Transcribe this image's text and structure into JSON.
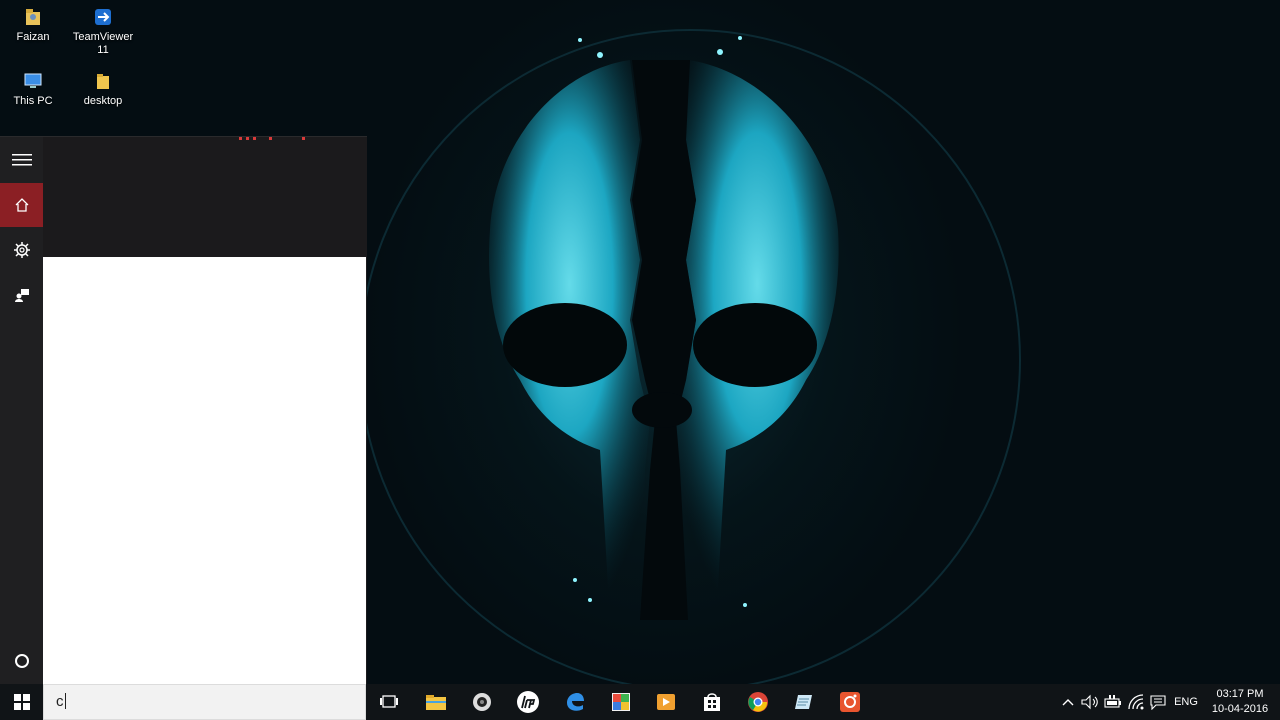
{
  "desktop": {
    "icons": [
      {
        "label": "Faizan",
        "icon": "user-folder-icon"
      },
      {
        "label": "TeamViewer 11",
        "icon": "teamviewer-icon"
      },
      {
        "label": "This PC",
        "icon": "computer-icon"
      },
      {
        "label": "desktop",
        "icon": "folder-icon"
      }
    ]
  },
  "start_panel": {
    "rail": [
      {
        "icon": "hamburger-menu-icon"
      },
      {
        "icon": "home-icon",
        "active": true
      },
      {
        "icon": "gear-icon"
      },
      {
        "icon": "feedback-icon"
      },
      {
        "icon": "cortana-circle-icon"
      }
    ]
  },
  "search": {
    "value": "c"
  },
  "taskbar": {
    "apps": [
      {
        "icon": "task-view-icon"
      },
      {
        "icon": "file-explorer-icon"
      },
      {
        "icon": "camera-app-icon"
      },
      {
        "icon": "hp-icon"
      },
      {
        "icon": "edge-icon"
      },
      {
        "icon": "paint-app-icon"
      },
      {
        "icon": "media-player-icon"
      },
      {
        "icon": "store-icon"
      },
      {
        "icon": "chrome-icon"
      },
      {
        "icon": "notes-app-icon"
      },
      {
        "icon": "screen-recorder-icon"
      }
    ],
    "tray": {
      "language": "ENG",
      "time": "03:17 PM",
      "date": "10-04-2016"
    }
  },
  "colors": {
    "accent": "#8b1f24",
    "taskbar": "#101417",
    "panel": "#1b1b1d"
  }
}
